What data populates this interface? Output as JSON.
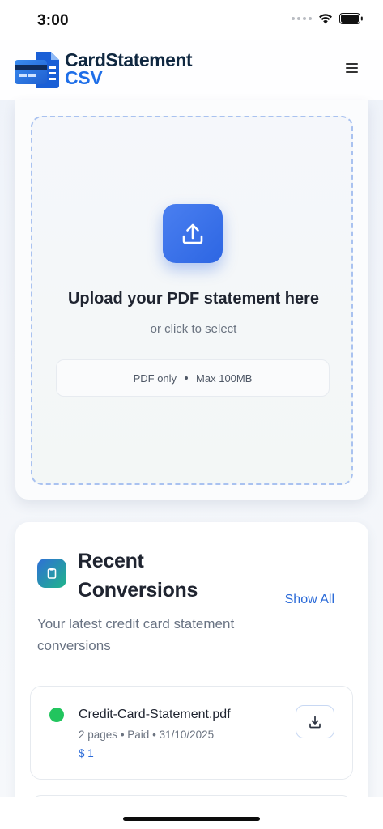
{
  "status_bar": {
    "time": "3:00"
  },
  "header": {
    "brand_line1": "CardStatement",
    "brand_line2": "CSV",
    "logo_icon": "card-document-logo",
    "menu_icon": "hamburger-menu-icon"
  },
  "upload": {
    "icon": "upload-icon",
    "title": "Upload your PDF statement here",
    "subtitle": "or click to select",
    "file_type": "PDF only",
    "max_size": "Max 100MB"
  },
  "recent": {
    "icon": "clipboard-icon",
    "title": "Recent Conversions",
    "show_all": "Show All",
    "description": "Your latest credit card statement conversions",
    "items": [
      {
        "filename": "Credit-Card-Statement.pdf",
        "pages": "2 pages",
        "status": "Paid",
        "date": "31/10/2025",
        "price": "$ 1",
        "status_color": "#22c55e"
      }
    ]
  },
  "colors": {
    "accent": "#2d66e3",
    "brand_dark": "#0f2740",
    "success": "#22c55e"
  }
}
